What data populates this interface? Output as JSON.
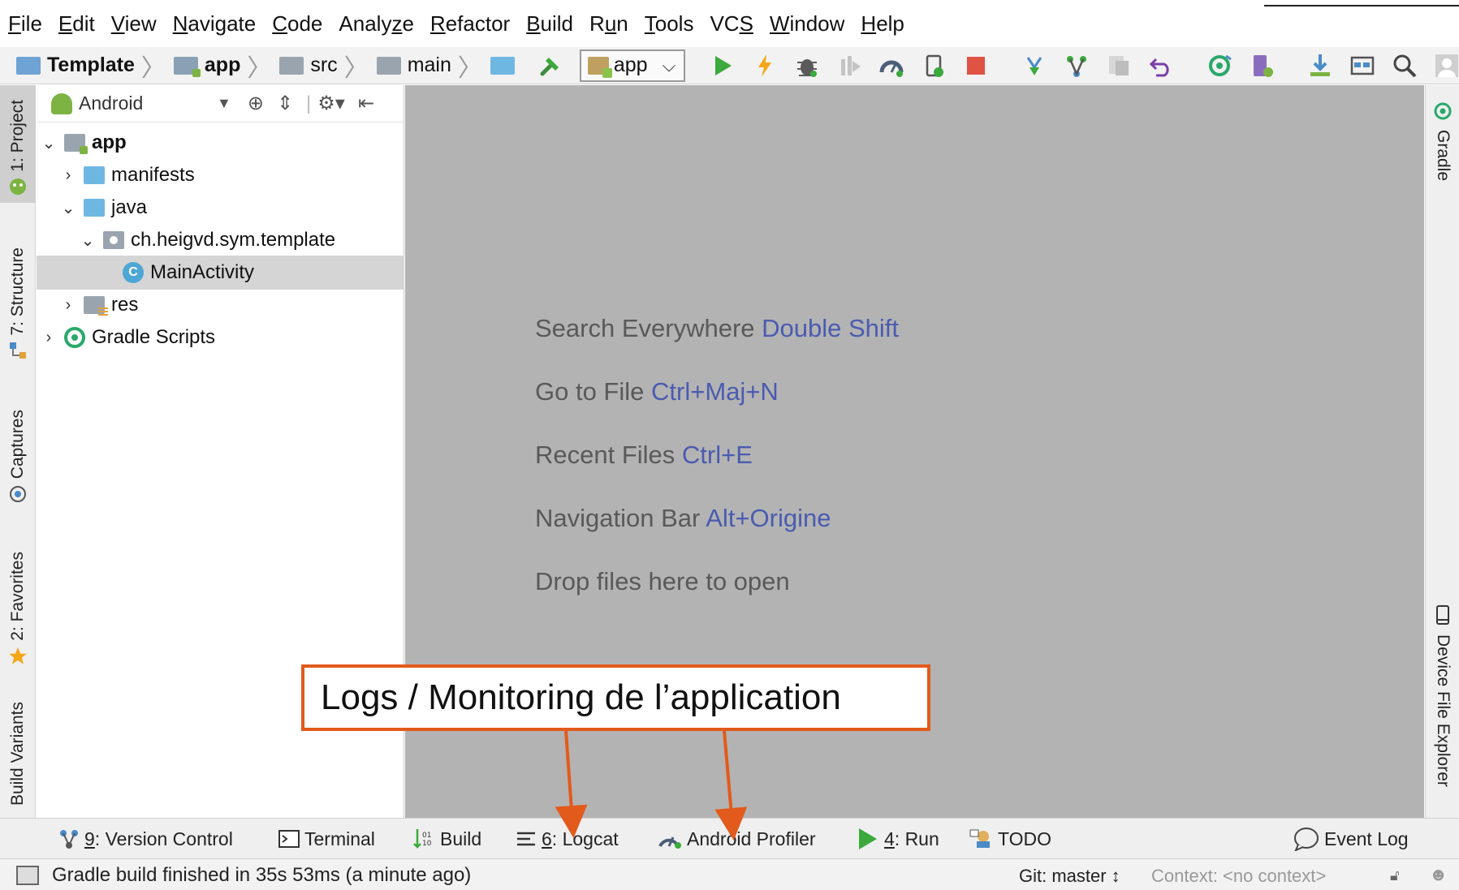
{
  "menu": [
    {
      "pre": "",
      "u": "F",
      "post": "ile"
    },
    {
      "pre": "",
      "u": "E",
      "post": "dit"
    },
    {
      "pre": "",
      "u": "V",
      "post": "iew"
    },
    {
      "pre": "",
      "u": "N",
      "post": "avigate"
    },
    {
      "pre": "",
      "u": "C",
      "post": "ode"
    },
    {
      "pre": "Analy",
      "u": "z",
      "post": "e"
    },
    {
      "pre": "",
      "u": "R",
      "post": "efactor"
    },
    {
      "pre": "",
      "u": "B",
      "post": "uild"
    },
    {
      "pre": "R",
      "u": "u",
      "post": "n"
    },
    {
      "pre": "",
      "u": "T",
      "post": "ools"
    },
    {
      "pre": "VC",
      "u": "S",
      "post": ""
    },
    {
      "pre": "",
      "u": "W",
      "post": "indow"
    },
    {
      "pre": "",
      "u": "H",
      "post": "elp"
    }
  ],
  "breadcrumb": {
    "project": "Template",
    "module": "app",
    "src": "src",
    "main": "main"
  },
  "run_config": {
    "label": "app"
  },
  "toolbar_icons": [
    "make-project-icon",
    "run-icon",
    "apply-changes-icon",
    "debug-icon",
    "coverage-icon",
    "profile-icon",
    "attach-debugger-icon",
    "stop-icon",
    "vcs-update-icon",
    "vcs-commit-icon",
    "vcs-history-icon",
    "vcs-revert-icon",
    "sync-gradle-icon",
    "avd-manager-icon",
    "sdk-manager-icon",
    "project-structure-icon",
    "search-icon",
    "account-icon"
  ],
  "left_tabs": {
    "project": "1: Project",
    "structure": "7: Structure",
    "captures": "Captures",
    "favorites": "2: Favorites",
    "build_variants": "Build Variants"
  },
  "project_panel": {
    "view_mode": "Android",
    "tree": {
      "app": "app",
      "manifests": "manifests",
      "java": "java",
      "package": "ch.heigvd.sym.template",
      "main_activity": "MainActivity",
      "res": "res",
      "gradle_scripts": "Gradle Scripts"
    }
  },
  "editor_hints": [
    {
      "text": "Search Everywhere",
      "shortcut": "Double Shift"
    },
    {
      "text": "Go to File",
      "shortcut": "Ctrl+Maj+N"
    },
    {
      "text": "Recent Files",
      "shortcut": "Ctrl+E"
    },
    {
      "text": "Navigation Bar",
      "shortcut": "Alt+Origine"
    },
    {
      "text": "Drop files here to open",
      "shortcut": ""
    }
  ],
  "right_tabs": {
    "gradle": "Gradle",
    "device_file_explorer": "Device File Explorer"
  },
  "bottom_tabs": {
    "version_control": {
      "num": "9",
      "label": ": Version Control"
    },
    "terminal": "Terminal",
    "build": "Build",
    "logcat": {
      "num": "6",
      "label": ": Logcat"
    },
    "android_profiler": "Android Profiler",
    "run": {
      "num": "4",
      "label": ": Run"
    },
    "todo": "TODO",
    "event_log": "Event Log"
  },
  "status_bar": {
    "message": "Gradle build finished in 35s 53ms (a minute ago)",
    "git": "Git: master ↕",
    "context": "Context: <no context>"
  },
  "annotation": {
    "text": "Logs / Monitoring de l’application",
    "color": "#e25a1c"
  },
  "colors": {
    "editor_bg": "#b3b3b3",
    "shortcut": "#4a5bb0",
    "run_green": "#3ca93c",
    "stop_red": "#e05243"
  }
}
